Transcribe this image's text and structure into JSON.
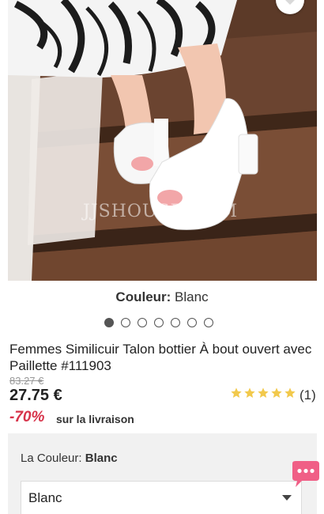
{
  "product_image": {
    "alt": "Femmes Similicuir Talon bottier À bout ouvert avec Paillette",
    "watermark": "JJSHOUSE.COM"
  },
  "icons": {
    "wishlist": "heart-icon",
    "dropdown": "chevron-down-icon",
    "chat": "chat-bubble-icon",
    "star": "star-icon"
  },
  "color_caption": {
    "label": "Couleur:",
    "value": "Blanc"
  },
  "carousel": {
    "total": 7,
    "active_index": 0
  },
  "product": {
    "title": "Femmes Similicuir Talon bottier À bout ouvert avec Paillette #111903",
    "old_price": "83.27 €",
    "price": "27.75 €",
    "discount": "-70%",
    "shipping_note": "sur la livraison",
    "rating_stars": 5,
    "review_count": "(1)"
  },
  "options": {
    "color_label": "La Couleur:",
    "color_value": "Blanc",
    "select_value": "Blanc"
  },
  "colors": {
    "accent_pink": "#d7334a",
    "star_gold": "#f2c94c",
    "chat_pink": "#f05f86"
  }
}
